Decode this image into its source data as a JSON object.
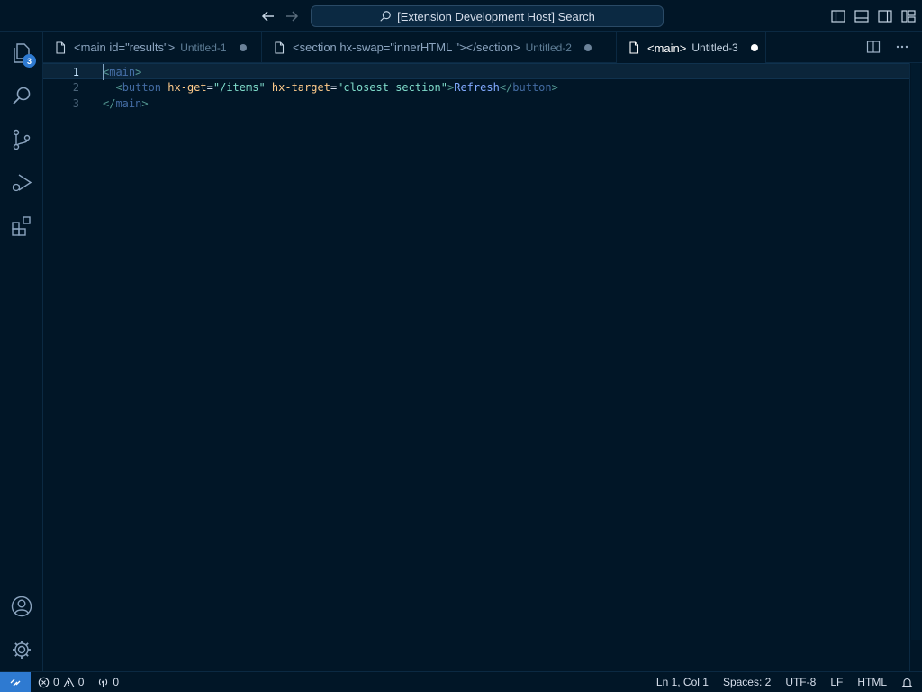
{
  "titlebar": {
    "search_text": "[Extension Development Host] Search"
  },
  "activity": {
    "explorer_badge": "3"
  },
  "tabs": [
    {
      "title": "<main id=\"results\">",
      "desc": "Untitled-1"
    },
    {
      "title": "<section hx-swap=\"innerHTML \"></section>",
      "desc": "Untitled-2"
    },
    {
      "title": "<main>",
      "desc": "Untitled-3"
    }
  ],
  "editor": {
    "line_numbers": [
      "1",
      "2",
      "3"
    ],
    "line1": {
      "open": "<",
      "tag": "main",
      "close": ">"
    },
    "line2": {
      "indent": "  ",
      "open": "<",
      "tag": "button",
      "attr1": "hx-get",
      "eq": "=",
      "val1": "\"/items\"",
      "attr2": "hx-target",
      "val2": "\"closest section\"",
      "gt": ">",
      "text": "Refresh",
      "close_open": "</",
      "close_tag": "button",
      "close_gt": ">"
    },
    "line3": {
      "open": "</",
      "tag": "main",
      "close": ">"
    }
  },
  "status": {
    "errors": "0",
    "warnings": "0",
    "ports": "0",
    "position": "Ln 1, Col 1",
    "spaces": "Spaces: 2",
    "encoding": "UTF-8",
    "eol": "LF",
    "language": "HTML"
  },
  "colors": {
    "accent": "#2e7ad1",
    "background": "#011627"
  }
}
